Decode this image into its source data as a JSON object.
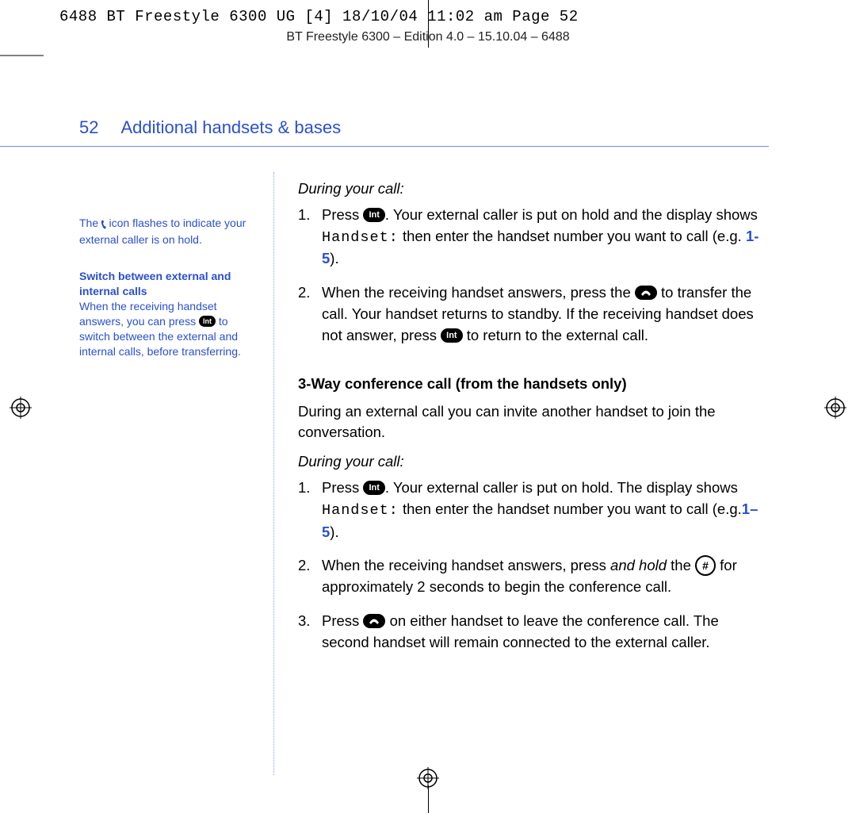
{
  "slug": "6488 BT Freestyle 6300 UG [4]  18/10/04  11:02 am  Page 52",
  "running_head": "BT Freestyle 6300 – Edition 4.0 – 15.10.04 – 6488",
  "page_number": "52",
  "section_title": "Additional handsets & bases",
  "sidebar": {
    "note1_pre": "The ",
    "note1_post": " icon flashes to indicate your external caller is on hold.",
    "note2_heading": "Switch between external and internal calls",
    "note2_body_pre": "When the receiving handset answers, you can press ",
    "note2_body_post": " to switch between the external and internal calls, before transferring."
  },
  "main": {
    "during_call_label": "During your call:",
    "sec1": {
      "s1_pre": "Press ",
      "s1_mid1": ". Your external caller is put on hold and the display shows ",
      "lcd": "Handset:",
      "s1_mid2": " then enter the handset number you want to call (e.g. ",
      "range": "1-5",
      "s1_post": ").",
      "s2_pre": "When the receiving handset answers, press the ",
      "s2_mid": " to transfer the call. Your handset returns to standby. If the receiving handset does not answer, press ",
      "s2_post": " to return to the external call."
    },
    "conf_heading": "3-Way conference call (from the handsets only)",
    "conf_intro": "During an external call you can invite another handset to join the conversation.",
    "sec2": {
      "s1_pre": "Press ",
      "s1_mid1": ". Your external caller is put on hold. The display shows ",
      "lcd": "Handset:",
      "s1_mid2": " then enter the handset number you want to call (e.g.",
      "range": "1–5",
      "s1_post": ").",
      "s2_pre": "When the receiving handset answers, press ",
      "s2_ital": "and hold",
      "s2_mid": " the ",
      "s2_post": " for approximately 2 seconds to begin the conference call.",
      "s3_pre": "Press ",
      "s3_post": " on either handset to leave the conference call. The second handset will remain connected to the external caller."
    }
  },
  "icons": {
    "int_key": "Int",
    "hash_key": "#"
  },
  "step_numbers": {
    "one": "1.",
    "two": "2.",
    "three": "3."
  }
}
